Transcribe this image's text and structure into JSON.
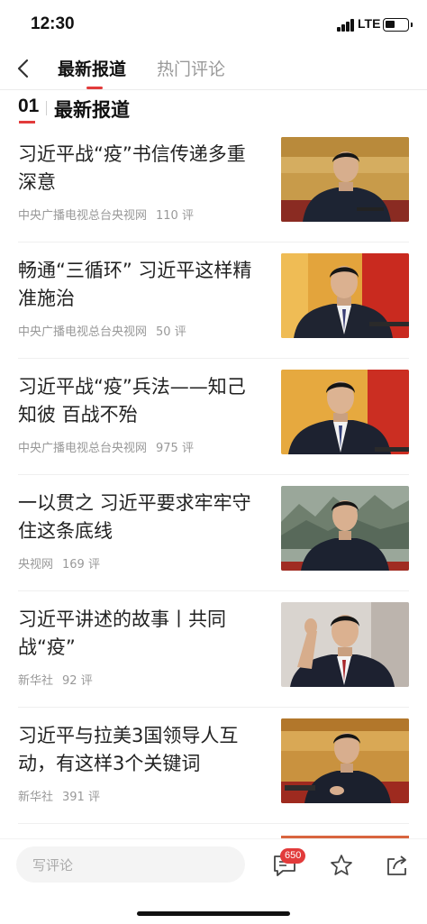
{
  "status_bar": {
    "time": "12:30",
    "network": "LTE",
    "battery_level": 0.45
  },
  "nav": {
    "tabs": [
      {
        "label": "最新报道",
        "active": true
      },
      {
        "label": "热门评论",
        "active": false
      }
    ]
  },
  "section": {
    "number": "01",
    "title": "最新报道"
  },
  "articles": [
    {
      "title": "习近平战“疫”书信传递多重深意",
      "source": "中央广播电视总台央视网",
      "comments": "110 评"
    },
    {
      "title": "畅通“三循环” 习近平这样精准施治",
      "source": "中央广播电视总台央视网",
      "comments": "50 评"
    },
    {
      "title": "习近平战“疫”兵法——知己知彼 百战不殆",
      "source": "中央广播电视总台央视网",
      "comments": "975 评"
    },
    {
      "title": "一以贯之 习近平要求牢牢守住这条底线",
      "source": "央视网",
      "comments": "169 评"
    },
    {
      "title": "习近平讲述的故事丨共同战“疫”",
      "source": "新华社",
      "comments": "92 评"
    },
    {
      "title": "习近平与拉美3国领导人互动，有这样3个关键词",
      "source": "新华社",
      "comments": "391 评"
    }
  ],
  "bottom_bar": {
    "comment_placeholder": "写评论",
    "comment_count": "650"
  },
  "colors": {
    "accent": "#e23b3b",
    "muted_text": "#999999"
  },
  "icons": [
    "back-icon",
    "comment-icon",
    "star-icon",
    "share-icon"
  ]
}
